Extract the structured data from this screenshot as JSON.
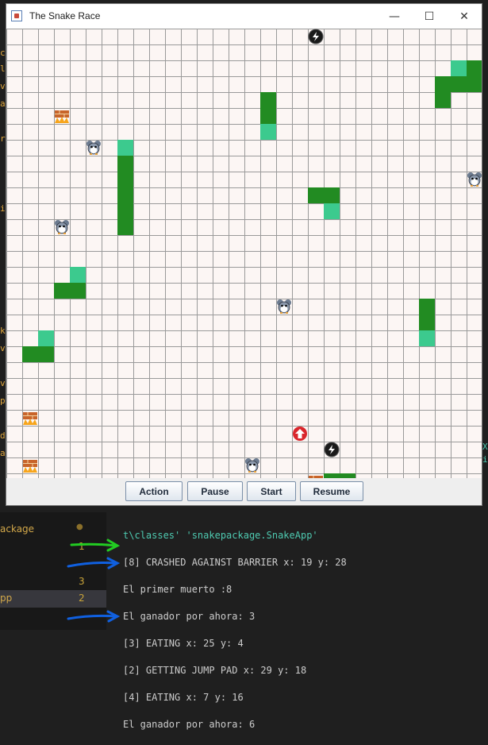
{
  "window": {
    "title": "The Snake Race",
    "controls": [
      "minimize-icon",
      "maximize-icon",
      "close-icon"
    ]
  },
  "board": {
    "columns": 30,
    "rows": 28,
    "background": "#fcf6f4",
    "grid_color": "#9a9a9a",
    "snake_body_color": "#228b22",
    "snake_head_color": "#3cca8e",
    "snakes": [
      {
        "head": [
          28,
          2
        ],
        "body": [
          [
            29,
            2
          ],
          [
            29,
            3
          ],
          [
            28,
            3
          ],
          [
            27,
            3
          ],
          [
            27,
            4
          ]
        ]
      },
      {
        "head": [
          16,
          6
        ],
        "body": [
          [
            16,
            5
          ],
          [
            16,
            4
          ]
        ]
      },
      {
        "head": [
          7,
          7
        ],
        "body": [
          [
            7,
            8
          ],
          [
            7,
            9
          ],
          [
            7,
            10
          ],
          [
            7,
            11
          ],
          [
            7,
            12
          ]
        ]
      },
      {
        "head": [
          20,
          11
        ],
        "body": [
          [
            20,
            10
          ],
          [
            19,
            10
          ]
        ]
      },
      {
        "head": [
          4,
          15
        ],
        "body": [
          [
            4,
            16
          ],
          [
            3,
            16
          ]
        ]
      },
      {
        "head": [
          26,
          19
        ],
        "body": [
          [
            26,
            18
          ],
          [
            26,
            17
          ]
        ]
      },
      {
        "head": [
          2,
          19
        ],
        "body": [
          [
            2,
            20
          ],
          [
            1,
            20
          ]
        ]
      },
      {
        "head": null,
        "body": [
          [
            20,
            28
          ],
          [
            21,
            28
          ]
        ]
      }
    ],
    "mice": [
      [
        5,
        7
      ],
      [
        29,
        9
      ],
      [
        3,
        12
      ],
      [
        17,
        17
      ],
      [
        15,
        27
      ]
    ],
    "barriers": [
      [
        3,
        5
      ],
      [
        1,
        24
      ],
      [
        1,
        27
      ],
      [
        19,
        28
      ]
    ],
    "turbo_boosts": [
      [
        19,
        0
      ],
      [
        20,
        26
      ]
    ],
    "jump_pads": [
      [
        18,
        25
      ]
    ],
    "icons": {
      "mouse": "mouse-icon",
      "barrier": "fire-barrier-icon",
      "turbo": "lightning-icon",
      "jump_pad": "jump-pad-arrow-icon"
    }
  },
  "buttons": {
    "action": "Action",
    "pause": "Pause",
    "start": "Start",
    "resume": "Resume"
  },
  "left_fragments": [
    "c",
    "lo",
    "v",
    "a",
    "r",
    "ir",
    "ka",
    "v",
    "va",
    "pp",
    "dı",
    "a"
  ],
  "right_fragments": [
    "X",
    "i"
  ],
  "panel": {
    "items": [
      {
        "label": "ackage",
        "badge": "●",
        "color": "#d4a94a"
      },
      {
        "label": "",
        "badge": "1",
        "color": "#c9a43a"
      },
      {
        "label": "",
        "badge": "3",
        "color": "#c9a43a"
      },
      {
        "label": "pp",
        "badge": "2",
        "color": "#d4a94a"
      }
    ]
  },
  "terminal": {
    "lines": [
      "t\\classes' 'snakepackage.SnakeApp'",
      "[8] CRASHED AGAINST BARRIER x: 19 y: 28",
      "El primer muerto :8",
      "El ganador por ahora: 3",
      "[3] EATING x: 25 y: 4",
      "[2] GETTING JUMP PAD x: 29 y: 18",
      "[4] EATING x: 7 y: 16",
      "El ganador por ahora: 6"
    ],
    "first_line_color": "#4ec9b0",
    "annotation_colors": {
      "green_arrow": "#22cc22",
      "blue_arrow": "#1060e0"
    }
  }
}
